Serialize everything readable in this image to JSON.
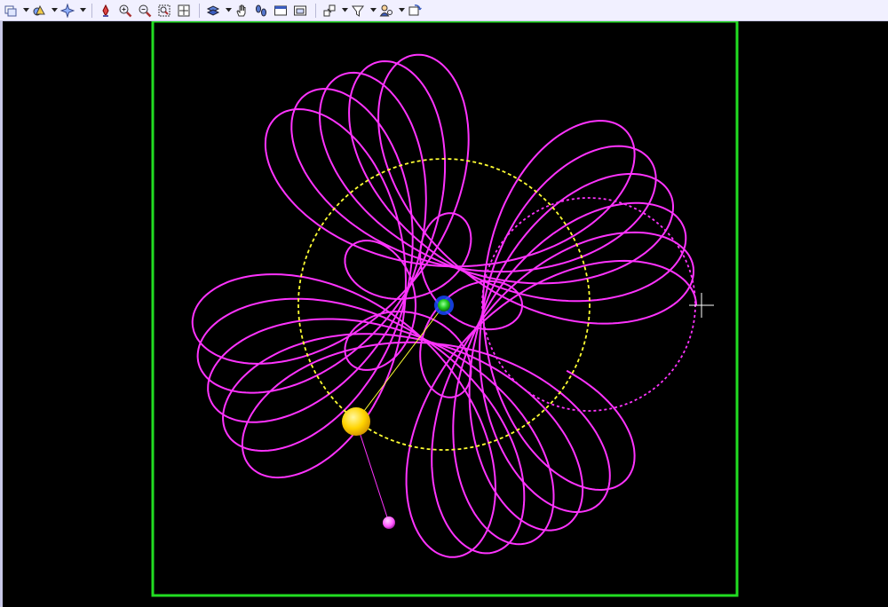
{
  "toolbar": {
    "buttons": [
      {
        "name": "view-options-icon",
        "dropdown": true
      },
      {
        "name": "shapes-icon",
        "dropdown": true
      },
      {
        "name": "effects-icon",
        "dropdown": true
      },
      {
        "name": "pen-tool-icon",
        "dropdown": false
      },
      {
        "name": "zoom-in-icon",
        "dropdown": false
      },
      {
        "name": "zoom-out-icon",
        "dropdown": false
      },
      {
        "name": "zoom-fit-icon",
        "dropdown": false
      },
      {
        "name": "zoom-all-icon",
        "dropdown": false
      },
      {
        "name": "layer-icon",
        "dropdown": true
      },
      {
        "name": "hand-pan-icon",
        "dropdown": false
      },
      {
        "name": "footsteps-icon",
        "dropdown": false
      },
      {
        "name": "window-icon",
        "dropdown": false
      },
      {
        "name": "frame-icon",
        "dropdown": false
      },
      {
        "name": "arrange-icon",
        "dropdown": true
      },
      {
        "name": "filter-icon",
        "dropdown": true
      },
      {
        "name": "person-search-icon",
        "dropdown": true
      },
      {
        "name": "refresh-icon",
        "dropdown": false
      }
    ]
  },
  "scene": {
    "colors": {
      "background": "#000000",
      "frame": "#22dd22",
      "trail": "#ff33ff",
      "orbit": "#ffff33",
      "sun": "#ffdd00",
      "center_body": "#22cc22",
      "center_halo": "#2266ff",
      "moon": "#ff66ff",
      "crosshair": "#ffffff"
    }
  }
}
